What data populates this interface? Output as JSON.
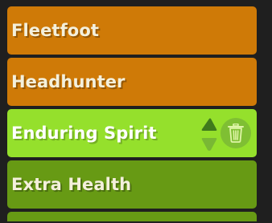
{
  "items": [
    {
      "label": "Fleetfoot"
    },
    {
      "label": "Headhunter"
    },
    {
      "label": "Enduring Spirit"
    },
    {
      "label": "Extra Health"
    }
  ],
  "colors": {
    "background": "#1f1f1f",
    "orange": "#cf7a07",
    "green": "#679a14",
    "active_green": "#95e02c",
    "text": "#f4f0dc"
  },
  "icons": {
    "move_up": "arrow-up-icon",
    "move_down": "arrow-down-icon",
    "delete": "trash-icon"
  }
}
